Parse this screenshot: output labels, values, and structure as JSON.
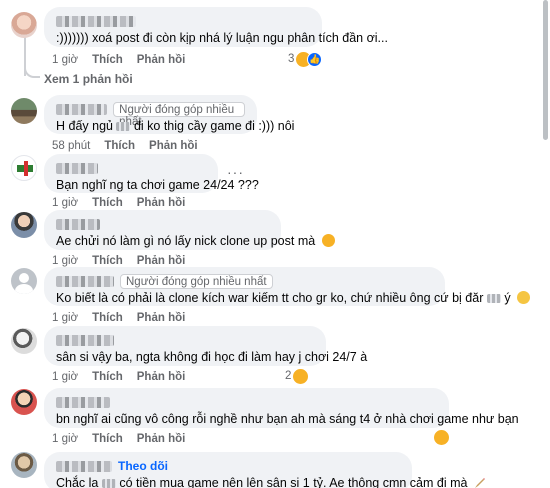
{
  "comments": [
    {
      "badge": "",
      "text": ":)))))))  xoá post đi còn kịp nhá lý luận ngu phân tích đần ơi...",
      "time": "1 giờ",
      "like": "Thích",
      "reply": "Phản hồi",
      "reaction_count": "3",
      "replies_link": "Xem 1 phản hồi"
    },
    {
      "badge": "Người đóng góp nhiều nhất",
      "text_before": "H đấy ngủ",
      "text_after": "đi ko thig cầy game đi :))) nôi",
      "time": "58 phút",
      "like": "Thích",
      "reply": "Phản hồi"
    },
    {
      "text": "Bạn nghĩ ng ta chơi game 24/24 ???",
      "time": "1 giờ",
      "like": "Thích",
      "reply": "Phản hồi",
      "more": "···"
    },
    {
      "text": "Ae chửi nó làm gì nó lấy nick clone up post mà",
      "time": "1 giờ",
      "like": "Thích",
      "reply": "Phản hồi"
    },
    {
      "badge": "Người đóng góp nhiều nhất",
      "text_before": "Ko biết là có phải là clone kích war kiếm tt cho gr ko, chứ nhiều ông cứ bị đăr",
      "text_after": "ý",
      "time": "1 giờ",
      "like": "Thích",
      "reply": "Phản hồi"
    },
    {
      "text": "sân si vậy ba, ngta không đi học đi làm hay j chơi 24/7 à",
      "time": "1 giờ",
      "like": "Thích",
      "reply": "Phản hồi",
      "reaction_count": "2"
    },
    {
      "text": "bn nghĩ ai cũng vô công rỗi nghề như bạn ah mà sáng t4 ở nhà chơi game như bạn",
      "time": "1 giờ",
      "like": "Thích",
      "reply": "Phản hồi"
    },
    {
      "follow": "Theo dõi",
      "text_before": "Chắc la",
      "text_after": "có tiền mua game nên lên sân si 1 tỷ. Ae thông cmn cảm đi mà"
    }
  ],
  "colors": {
    "bubble": "#f0f2f5",
    "meta": "#65676b",
    "link": "#0866ff",
    "haha": "#f7b125"
  },
  "icons": [
    "haha-emoji",
    "like-icon",
    "more-icon",
    "pen-icon"
  ]
}
